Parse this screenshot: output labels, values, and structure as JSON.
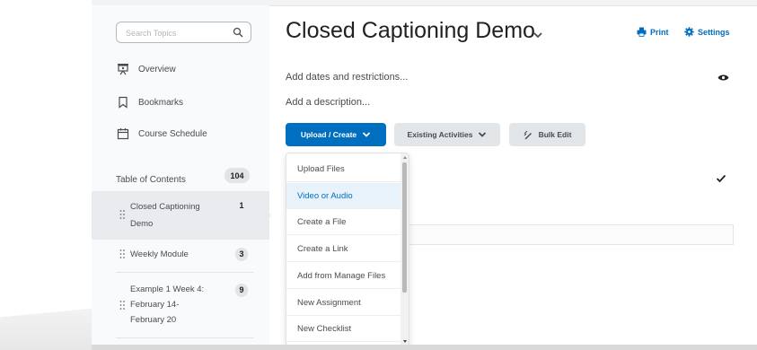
{
  "sidebar": {
    "search_placeholder": "Search Topics",
    "nav": [
      {
        "label": "Overview",
        "icon": "presentation-board-icon"
      },
      {
        "label": "Bookmarks",
        "icon": "bookmark-icon"
      },
      {
        "label": "Course Schedule",
        "icon": "calendar-icon"
      }
    ],
    "toc": {
      "label": "Table of Contents",
      "count": "104"
    },
    "units": [
      {
        "line1": "Closed Captioning",
        "line2": "Demo",
        "count": "1",
        "active": true
      },
      {
        "line1": "Weekly Module",
        "count": "3"
      },
      {
        "line1": "Example 1 Week 4:",
        "line2": "February 14-",
        "line3": "February 20",
        "count": "9"
      }
    ]
  },
  "main": {
    "title": "Closed Captioning Demo",
    "print_label": "Print",
    "settings_label": "Settings",
    "dates_link": "Add dates and restrictions...",
    "description_link": "Add a description...",
    "upload_create_label": "Upload / Create",
    "existing_activities_label": "Existing Activities",
    "bulk_edit_label": "Bulk Edit"
  },
  "menu": {
    "items": [
      {
        "label": "Upload Files"
      },
      {
        "label": "Video or Audio",
        "highlighted": true
      },
      {
        "label": "Create a File"
      },
      {
        "label": "Create a Link"
      },
      {
        "label": "Add from Manage Files"
      },
      {
        "label": "New Assignment"
      },
      {
        "label": "New Checklist"
      }
    ]
  },
  "colors": {
    "accent": "#006fbf",
    "text": "#494c4e",
    "highlight": "#e8f2fb"
  }
}
